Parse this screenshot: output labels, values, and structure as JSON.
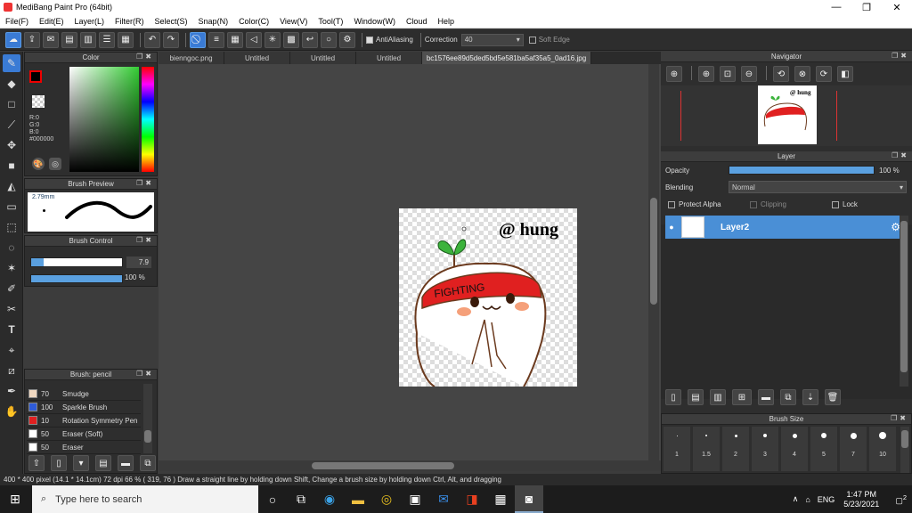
{
  "titlebar": {
    "title": "MediBang Paint Pro (64bit)",
    "minimize": "—",
    "maximize": "❐",
    "close": "✕"
  },
  "menu": [
    "File(F)",
    "Edit(E)",
    "Layer(L)",
    "Filter(R)",
    "Select(S)",
    "Snap(N)",
    "Color(C)",
    "View(V)",
    "Tool(T)",
    "Window(W)",
    "Cloud",
    "Help"
  ],
  "toolbar": {
    "antialiasing": "AntiAliasing",
    "correction_label": "Correction",
    "correction_value": "40",
    "soft_edge": "Soft Edge"
  },
  "tabs": [
    "bienngoc.png",
    "Untitled",
    "Untitled",
    "Untitled",
    "bc1576ee89d5ded5bd5e581ba5af35a5_0ad16.jpg"
  ],
  "color_panel": {
    "title": "Color",
    "r": "R:0",
    "g": "G:0",
    "b": "B:0",
    "hex": "#000000",
    "fg": "#000000",
    "bg": "#ffffff"
  },
  "brush_preview": {
    "title": "Brush Preview",
    "size": "2.79mm"
  },
  "brush_control": {
    "title": "Brush Control",
    "size_value": "7.9",
    "opacity_value": "100 %"
  },
  "brush_list": {
    "title": "Brush: pencil",
    "items": [
      {
        "size": "70",
        "name": "Smudge",
        "color": "#f0d8c0"
      },
      {
        "size": "100",
        "name": "Sparkle Brush",
        "color": "#2e5bd8"
      },
      {
        "size": "10",
        "name": "Rotation Symmetry Pen",
        "color": "#e02020"
      },
      {
        "size": "50",
        "name": "Eraser (Soft)",
        "color": "#ffffff"
      },
      {
        "size": "50",
        "name": "Eraser",
        "color": "#ffffff"
      }
    ]
  },
  "navigator": {
    "title": "Navigator"
  },
  "layer_panel": {
    "title": "Layer",
    "opacity_label": "Opacity",
    "opacity_value": "100 %",
    "blending_label": "Blending",
    "blending_value": "Normal",
    "protect_alpha": "Protect Alpha",
    "clipping": "Clipping",
    "lock": "Lock",
    "layer_name": "Layer2"
  },
  "brush_size": {
    "title": "Brush Size",
    "values": [
      "1",
      "1.5",
      "2",
      "3",
      "4",
      "5",
      "7",
      "10"
    ]
  },
  "artwork": {
    "signature": "@ hung",
    "headband": "FIGHTING"
  },
  "status": {
    "text": "400 * 400 pixel  (14.1 * 14.1cm)  72 dpi  66 %  ( 319, 76 )  Draw a straight line by holding down Shift, Change a brush size by holding down Ctrl, Alt, and dragging"
  },
  "taskbar": {
    "search_placeholder": "Type here to search",
    "lang": "ENG",
    "time": "1:47 PM",
    "date": "5/23/2021",
    "notif": "2"
  }
}
